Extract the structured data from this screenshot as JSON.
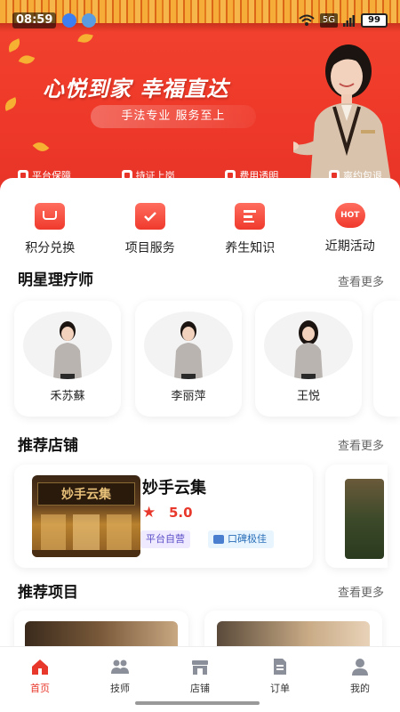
{
  "status_bar": {
    "time": "08:59",
    "battery": "99",
    "signal_label": "5G"
  },
  "hero": {
    "title": "心悦到家 幸福直达",
    "subtitle": "手法专业 服务至上",
    "guarantees": [
      {
        "label": "平台保障",
        "icon": "shield-icon"
      },
      {
        "label": "持证上岗",
        "icon": "id-card-icon"
      },
      {
        "label": "费用透明",
        "icon": "money-icon"
      },
      {
        "label": "爽约包退",
        "icon": "refund-icon"
      }
    ]
  },
  "quick_menu": [
    {
      "label": "积分兑换",
      "icon": "shopping-bag-icon"
    },
    {
      "label": "项目服务",
      "icon": "checklist-icon"
    },
    {
      "label": "养生知识",
      "icon": "book-icon"
    },
    {
      "label": "近期活动",
      "icon": "hot-icon",
      "badge": "HOT"
    }
  ],
  "therapists_section": {
    "title": "明星理疗师",
    "more": "查看更多",
    "items": [
      {
        "name": "禾苏蘇"
      },
      {
        "name": "李丽萍"
      },
      {
        "name": "王悦"
      }
    ]
  },
  "shops_section": {
    "title": "推荐店铺",
    "more": "查看更多",
    "shop": {
      "name": "妙手云集",
      "sign_text": "妙手云集",
      "rating": "5.0",
      "tags": [
        "平台自营",
        "口碑极佳"
      ]
    }
  },
  "projects_section": {
    "title": "推荐项目",
    "more": "查看更多"
  },
  "bottom_nav": [
    {
      "label": "首页",
      "icon": "home-icon",
      "active": true
    },
    {
      "label": "技师",
      "icon": "people-icon",
      "active": false
    },
    {
      "label": "店铺",
      "icon": "store-icon",
      "active": false
    },
    {
      "label": "订单",
      "icon": "order-icon",
      "active": false
    },
    {
      "label": "我的",
      "icon": "user-icon",
      "active": false
    }
  ],
  "colors": {
    "brand_red": "#e8382c",
    "hero_red": "#f2432f",
    "gold": "#f6b83a"
  }
}
